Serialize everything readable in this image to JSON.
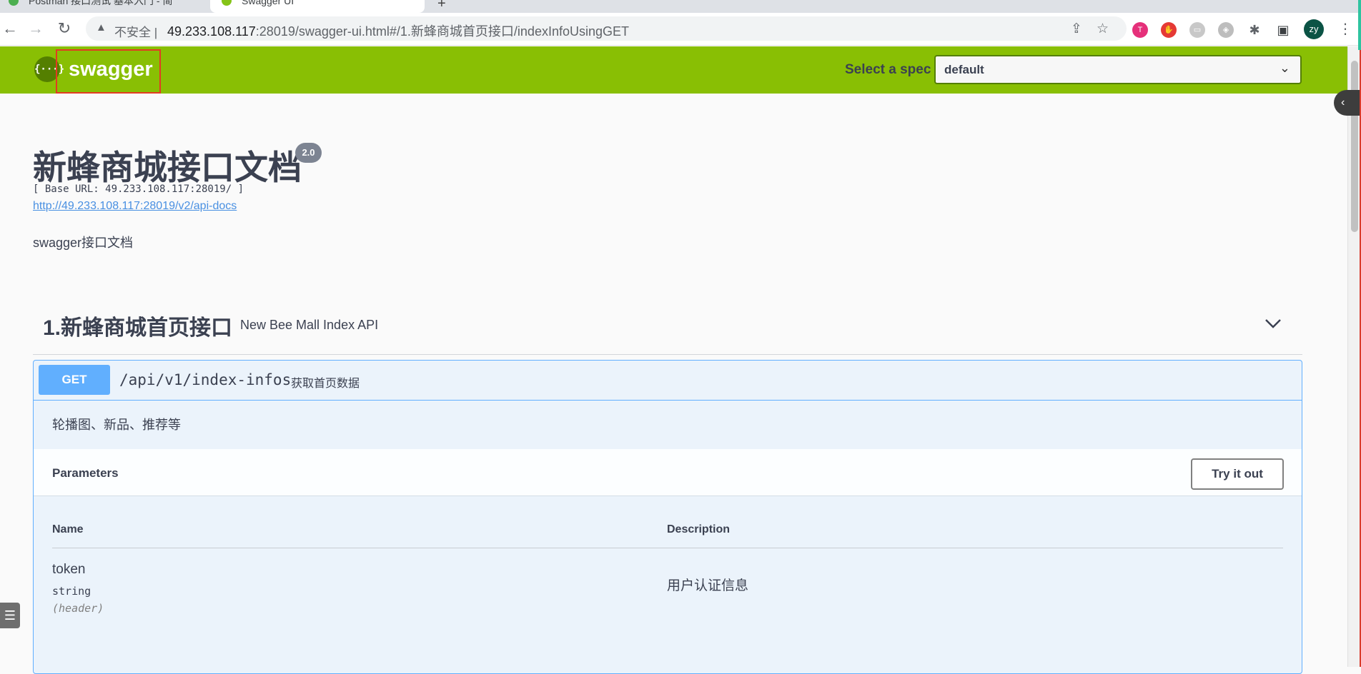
{
  "browser": {
    "tabs": [
      {
        "title": "Postman 接口测试 基本入门 - 简",
        "active": false
      },
      {
        "title": "Swagger UI",
        "active": true
      }
    ],
    "omnibox": {
      "security_label": "不安全",
      "url_host": "49.233.108.117",
      "url_rest": ":28019/swagger-ui.html#/1.新蜂商城首页接口/indexInfoUsingGET"
    },
    "profile_initials": "zy"
  },
  "swagger": {
    "logo_text": "swagger",
    "logo_icon_text": "{···}",
    "spec_label": "Select a spec",
    "spec_value": "default"
  },
  "info": {
    "title": "新蜂商城接口文档",
    "version": "2.0",
    "base_url": "[ Base URL: 49.233.108.117:28019/ ]",
    "api_docs_link": "http://49.233.108.117:28019/v2/api-docs",
    "description": "swagger接口文档"
  },
  "tag": {
    "name": "1.新蜂商城首页接口",
    "description": "New Bee Mall Index API"
  },
  "operation": {
    "method": "GET",
    "path": "/api/v1/index-infos",
    "summary": "获取首页数据",
    "description": "轮播图、新品、推荐等",
    "parameters_label": "Parameters",
    "try_it_out_label": "Try it out",
    "columns": [
      "Name",
      "Description"
    ],
    "params": [
      {
        "name": "token",
        "type": "string",
        "in": "(header)",
        "description": "用户认证信息"
      }
    ]
  },
  "colors": {
    "topbar": "#89bf04",
    "get_method": "#61affe",
    "opblock_bg": "#ebf3fb",
    "link": "#4990e2"
  }
}
